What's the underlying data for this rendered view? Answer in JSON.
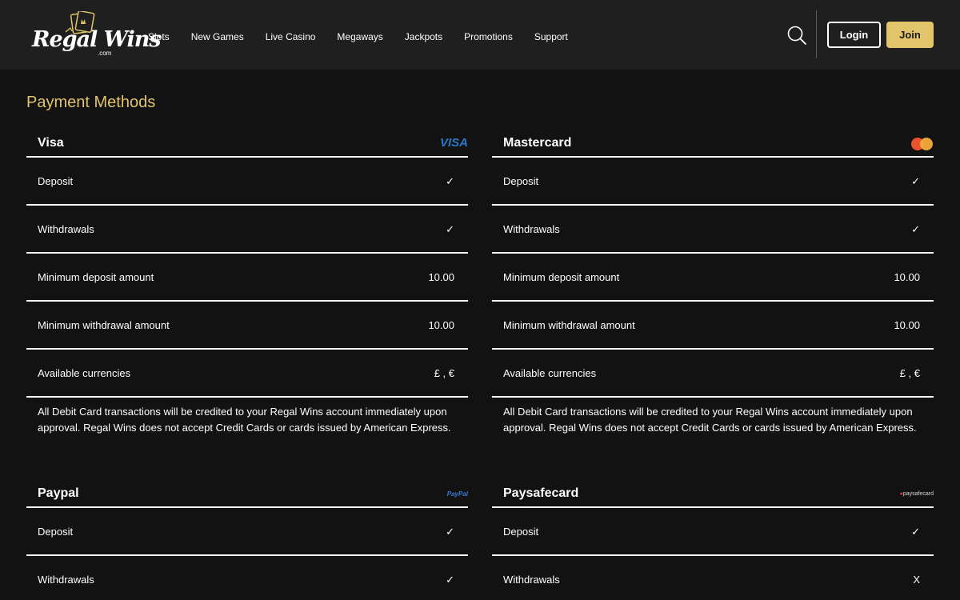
{
  "brand": {
    "logo_text": "Regal Wins",
    "logo_sub": ".com"
  },
  "nav": {
    "items": [
      "Slots",
      "New Games",
      "Live Casino",
      "Megaways",
      "Jackpots",
      "Promotions",
      "Support"
    ]
  },
  "header": {
    "login_label": "Login",
    "join_label": "Join",
    "search_icon": "search-icon"
  },
  "page": {
    "title": "Payment Methods"
  },
  "colors": {
    "accent": "#e2c46a",
    "background": "#121212",
    "header_bg": "#1f1f1f"
  },
  "methods": [
    {
      "name": "Visa",
      "logo_text": "VISA",
      "rows": [
        {
          "label": "Deposit",
          "value": "✓"
        },
        {
          "label": "Withdrawals",
          "value": "✓"
        },
        {
          "label": "Minimum deposit amount",
          "value": "10.00"
        },
        {
          "label": "Minimum withdrawal amount",
          "value": "10.00"
        },
        {
          "label": "Available currencies",
          "value": "£ , €"
        }
      ],
      "note": "All Debit Card transactions will be credited to your Regal Wins account immediately upon approval. Regal Wins does not accept Credit Cards or cards issued by American Express."
    },
    {
      "name": "Mastercard",
      "rows": [
        {
          "label": "Deposit",
          "value": "✓"
        },
        {
          "label": "Withdrawals",
          "value": "✓"
        },
        {
          "label": "Minimum deposit amount",
          "value": "10.00"
        },
        {
          "label": "Minimum withdrawal amount",
          "value": "10.00"
        },
        {
          "label": "Available currencies",
          "value": "£ , €"
        }
      ],
      "note": "All Debit Card transactions will be credited to your Regal Wins account immediately upon approval. Regal Wins does not accept Credit Cards or cards issued by American Express."
    },
    {
      "name": "Paypal",
      "logo_text": "PayPal",
      "rows": [
        {
          "label": "Deposit",
          "value": "✓"
        },
        {
          "label": "Withdrawals",
          "value": "✓"
        }
      ]
    },
    {
      "name": "Paysafecard",
      "logo_text": "paysafecard",
      "rows": [
        {
          "label": "Deposit",
          "value": "✓"
        },
        {
          "label": "Withdrawals",
          "value": "X"
        }
      ]
    }
  ]
}
